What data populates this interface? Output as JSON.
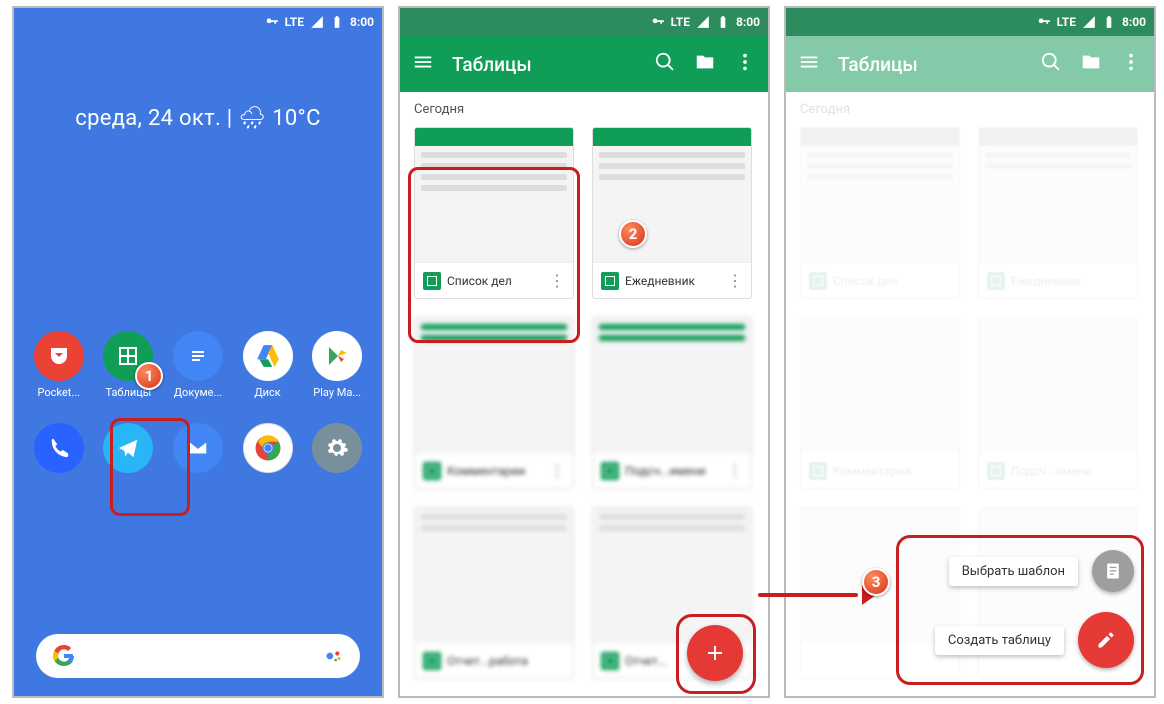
{
  "status": {
    "time": "8:00",
    "net": "LTE"
  },
  "home": {
    "weather": "среда, 24 окт. | 🌧 10°C",
    "apps_row1": [
      {
        "label": "Pocket...",
        "color": "#EA4335"
      },
      {
        "label": "Таблицы",
        "color": "#0F9D58"
      },
      {
        "label": "Докуме...",
        "color": "#4285F4"
      },
      {
        "label": "Диск",
        "color": "#FFFFFF"
      },
      {
        "label": "Play Ма...",
        "color": "#FFFFFF"
      }
    ]
  },
  "sheets": {
    "title": "Таблицы",
    "section": "Сегодня",
    "docs": [
      {
        "name": "Список дел"
      },
      {
        "name": "Ежедневник"
      },
      {
        "name": "Комментарии"
      },
      {
        "name": "Подсч...имени"
      },
      {
        "name": "Отчет...работа"
      },
      {
        "name": "Отчет..."
      }
    ],
    "fabmenu": {
      "template": "Выбрать шаблон",
      "create": "Создать таблицу"
    }
  },
  "badges": {
    "b1": "1",
    "b2": "2",
    "b3": "3"
  }
}
